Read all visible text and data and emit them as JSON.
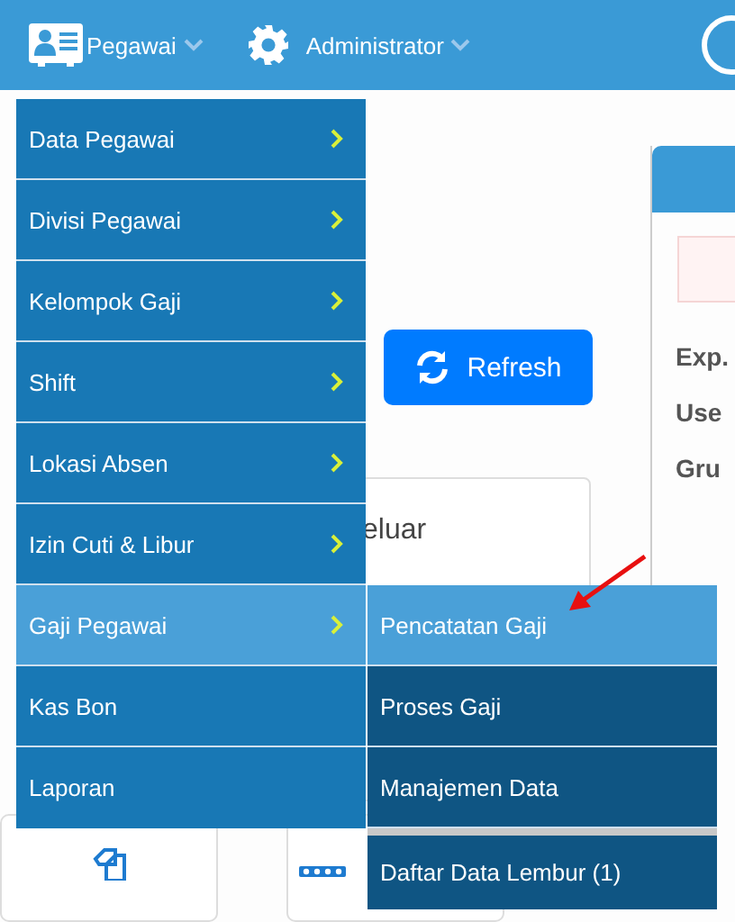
{
  "header": {
    "menus": [
      {
        "label": "Pegawai",
        "kind": "idcard"
      },
      {
        "label": "Administrator",
        "kind": "gear"
      }
    ]
  },
  "menu": {
    "items": [
      {
        "label": "Data Pegawai",
        "has_submenu": true,
        "selected": false
      },
      {
        "label": "Divisi Pegawai",
        "has_submenu": true,
        "selected": false
      },
      {
        "label": "Kelompok Gaji",
        "has_submenu": true,
        "selected": false
      },
      {
        "label": "Shift",
        "has_submenu": true,
        "selected": false
      },
      {
        "label": "Lokasi Absen",
        "has_submenu": true,
        "selected": false
      },
      {
        "label": "Izin Cuti & Libur",
        "has_submenu": true,
        "selected": false
      },
      {
        "label": "Gaji Pegawai",
        "has_submenu": true,
        "selected": true
      },
      {
        "label": "Kas Bon",
        "has_submenu": false,
        "selected": false
      },
      {
        "label": "Laporan",
        "has_submenu": false,
        "selected": false
      }
    ],
    "submenu": [
      {
        "label": "Pencatatan Gaji",
        "selected": true,
        "separated": false
      },
      {
        "label": "Proses Gaji",
        "selected": false,
        "separated": false
      },
      {
        "label": "Manajemen Data",
        "selected": false,
        "separated": false
      },
      {
        "label": "Daftar Data Lembur (1)",
        "selected": false,
        "separated": true
      }
    ]
  },
  "refresh_button": "Refresh",
  "card_text": "eluar",
  "panel": {
    "labels": [
      "Exp.",
      "Use",
      "Gru"
    ]
  }
}
